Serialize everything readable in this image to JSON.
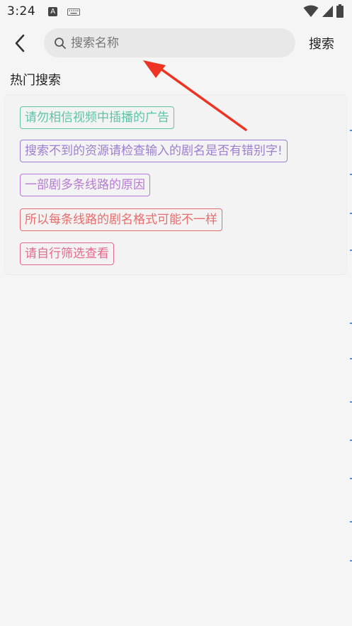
{
  "status_bar": {
    "time": "3:24",
    "app_icon_letter": "A",
    "icons": [
      "keyboard-icon",
      "wifi-icon",
      "signal-icon",
      "battery-icon"
    ]
  },
  "top_bar": {
    "search_placeholder": "搜索名称",
    "search_value": "",
    "search_action_label": "搜索"
  },
  "hot_search": {
    "title": "热门搜索",
    "tags": [
      {
        "label": "请勿相信视频中插播的广告",
        "color": "#5cc4a8"
      },
      {
        "label": "搜索不到的资源请检查输入的剧名是否有错别字!",
        "color": "#9b7fd1"
      },
      {
        "label": "一部剧多条线路的原因",
        "color": "#b77ad6"
      },
      {
        "label": "所以每条线路的剧名格式可能不一样",
        "color": "#e86d6d"
      },
      {
        "label": "请自行筛选查看",
        "color": "#e46b8d"
      }
    ]
  },
  "colors": {
    "annotation_arrow": "#ee3322",
    "background": "#f5f5f5",
    "search_box": "#e8e8e8"
  }
}
